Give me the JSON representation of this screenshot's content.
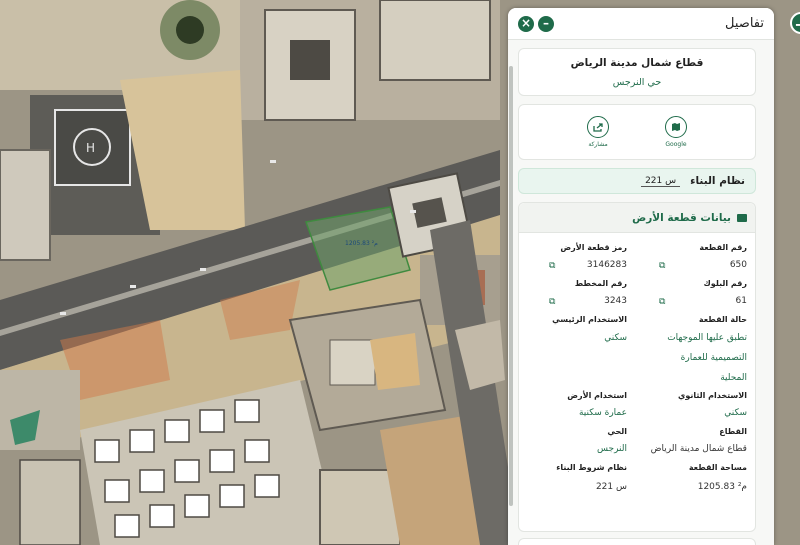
{
  "panel": {
    "title": "تفاصيل",
    "minimize_icon": "minus-icon",
    "close_icon": "close-icon"
  },
  "map_controls": {
    "zoom_in_icon": "plus-icon",
    "zoom_out_icon": "minus-icon"
  },
  "map_labels": {
    "parcel_area": "1205.83 م²"
  },
  "header_card": {
    "sector": "قطاع شمال مدينة الرياض",
    "district": "حي النرجس"
  },
  "actions": [
    {
      "label": "Google",
      "icon": "map-icon"
    },
    {
      "label": "مشاركة",
      "icon": "share-icon"
    }
  ],
  "building_system": {
    "label": "نظام البناء",
    "value": "س 221"
  },
  "land_data": {
    "title": "بيانات قطعة الأرض",
    "icon": "map-flag-icon",
    "fields": {
      "parcel_number_label": "رقم القطعة",
      "parcel_number_value": "650",
      "parcel_code_label": "رمز قطعة الأرض",
      "parcel_code_value": "3146283",
      "block_number_label": "رقم البلوك",
      "block_number_value": "61",
      "plan_number_label": "رقم المخطط",
      "plan_number_value": "3243",
      "parcel_status_label": "حالة القطعة",
      "parcel_status_value_1": "تطبق عليها الموجهات",
      "parcel_status_value_2": "التصميمية للعمارة",
      "parcel_status_value_3": "المحلية",
      "primary_use_label": "الاستخدام الرئيسي",
      "primary_use_value": "سكني",
      "secondary_use_label": "الاستخدام الثانوي",
      "secondary_use_value": "سكني",
      "land_use_label": "استخدام الأرض",
      "land_use_value": "عمارة سكنية",
      "sector_label": "القطاع",
      "sector_value": "قطاع شمال مدينة الرياض",
      "district_label": "الحي",
      "district_value": "النرجس",
      "area_label": "مساحة القطعة",
      "area_value": "1205.83 م²",
      "building_conditions_label": "نظام شروط البناء",
      "building_conditions_value": "س 221"
    }
  },
  "colors": {
    "accent": "#1f6b4a",
    "panel_bg": "#f7f8f6",
    "highlight_bg": "#e9f5ef"
  }
}
